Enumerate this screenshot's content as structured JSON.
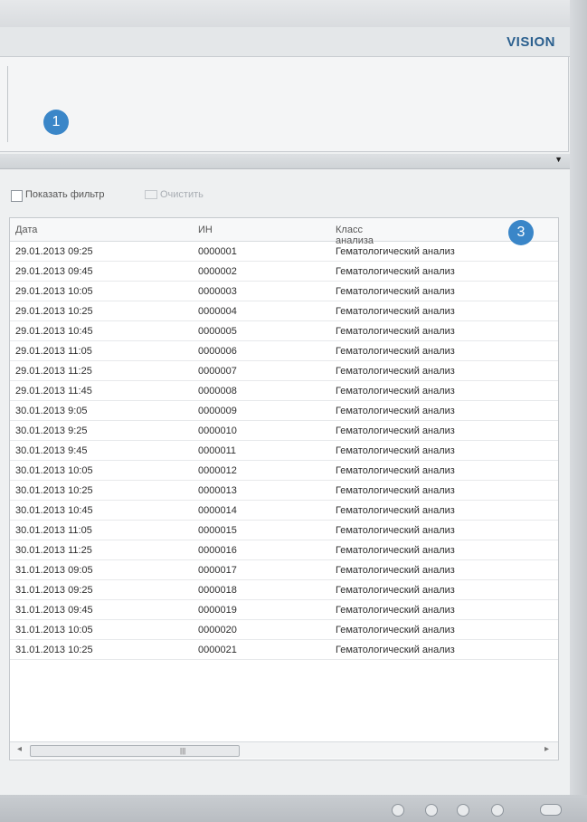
{
  "app": {
    "logo": "VISION"
  },
  "markers": {
    "header_marker": "1",
    "grid_marker": "3"
  },
  "toolbar": {
    "show_filter_label": "Показать фильтр",
    "clear_label": "Очистить"
  },
  "table": {
    "headers": [
      "Дата",
      "ИН",
      "Класс анализа"
    ],
    "rows": [
      [
        "29.01.2013 09:25",
        "0000001",
        "Гематологический анализ"
      ],
      [
        "29.01.2013 09:45",
        "0000002",
        "Гематологический анализ"
      ],
      [
        "29.01.2013 10:05",
        "0000003",
        "Гематологический анализ"
      ],
      [
        "29.01.2013 10:25",
        "0000004",
        "Гематологический анализ"
      ],
      [
        "29.01.2013 10:45",
        "0000005",
        "Гематологический анализ"
      ],
      [
        "29.01.2013 11:05",
        "0000006",
        "Гематологический анализ"
      ],
      [
        "29.01.2013 11:25",
        "0000007",
        "Гематологический анализ"
      ],
      [
        "29.01.2013 11:45",
        "0000008",
        "Гематологический анализ"
      ],
      [
        "30.01.2013 9:05",
        "0000009",
        "Гематологический анализ"
      ],
      [
        "30.01.2013 9:25",
        "0000010",
        "Гематологический анализ"
      ],
      [
        "30.01.2013 9:45",
        "0000011",
        "Гематологический анализ"
      ],
      [
        "30.01.2013 10:05",
        "0000012",
        "Гематологический анализ"
      ],
      [
        "30.01.2013 10:25",
        "0000013",
        "Гематологический анализ"
      ],
      [
        "30.01.2013 10:45",
        "0000014",
        "Гематологический анализ"
      ],
      [
        "30.01.2013 11:05",
        "0000015",
        "Гематологический анализ"
      ],
      [
        "30.01.2013 11:25",
        "0000016",
        "Гематологический анализ"
      ],
      [
        "31.01.2013 09:05",
        "0000017",
        "Гематологический анализ"
      ],
      [
        "31.01.2013 09:25",
        "0000018",
        "Гематологический анализ"
      ],
      [
        "31.01.2013 09:45",
        "0000019",
        "Гематологический анализ"
      ],
      [
        "31.01.2013 10:05",
        "0000020",
        "Гематологический анализ"
      ],
      [
        "31.01.2013 10:25",
        "0000021",
        "Гематологический анализ"
      ]
    ]
  },
  "icons": {
    "collapse": "chevron-down-icon",
    "scroll_left": "arrow-left-icon",
    "scroll_right": "arrow-right-icon"
  }
}
